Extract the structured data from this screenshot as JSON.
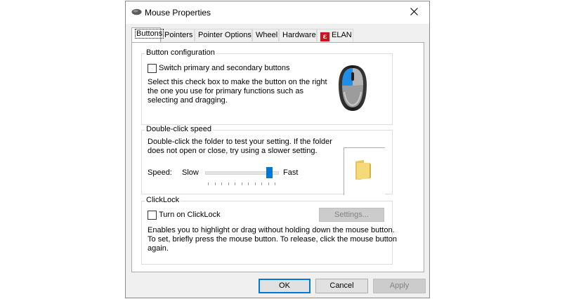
{
  "window": {
    "title": "Mouse Properties"
  },
  "tabs": [
    {
      "label": "Buttons",
      "active": true
    },
    {
      "label": "Pointers"
    },
    {
      "label": "Pointer Options"
    },
    {
      "label": "Wheel"
    },
    {
      "label": "Hardware"
    },
    {
      "label": "ELAN",
      "icon": "elan-icon"
    }
  ],
  "button_config": {
    "legend": "Button configuration",
    "checkbox_label": "Switch primary and secondary buttons",
    "checked": false,
    "description_lines": [
      "Select this check box to make the button on the right",
      "the one you use for primary functions such as",
      "selecting and dragging."
    ],
    "image_icon": "mouse-icon"
  },
  "double_click": {
    "legend": "Double-click speed",
    "description_lines": [
      "Double-click the folder to test your setting. If the folder",
      "does not open or close, try using a slower setting."
    ],
    "speed_label": "Speed:",
    "slow_label": "Slow",
    "fast_label": "Fast",
    "speed_level": 0.93,
    "test_icon": "folder-icon"
  },
  "clicklock": {
    "legend": "ClickLock",
    "checkbox_label": "Turn on ClickLock",
    "checked": false,
    "settings_label": "Settings...",
    "description_lines": [
      "Enables you to highlight or drag without holding down the mouse button.",
      "To set, briefly press the mouse button. To release, click the mouse button",
      "again."
    ]
  },
  "buttons": {
    "ok": "OK",
    "cancel": "Cancel",
    "apply": "Apply"
  },
  "colors": {
    "accent": "#0078d7",
    "mouse_highlight": "#1e8fe6"
  }
}
